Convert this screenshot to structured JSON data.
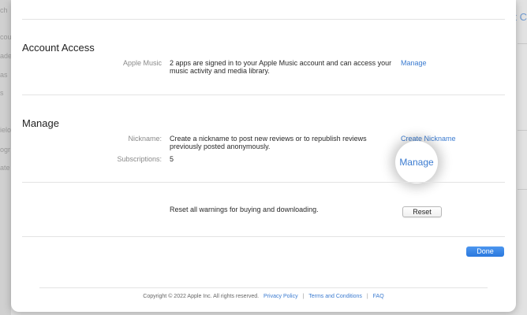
{
  "background": {
    "sidebar_fragments": [
      "ch",
      "cou",
      "ade",
      "as",
      "s",
      "ielo",
      "ogr",
      "ate"
    ],
    "right_fragment": "t C"
  },
  "account_access": {
    "title": "Account Access",
    "apple_music_label": "Apple Music",
    "apple_music_text": "2 apps are signed in to your Apple Music account and can access your music activity and media library.",
    "apple_music_link": "Manage"
  },
  "manage": {
    "title": "Manage",
    "nickname_label": "Nickname:",
    "nickname_text": "Create a nickname to post new reviews or to republish reviews previously posted anonymously.",
    "nickname_link": "Create Nickname",
    "subscriptions_label": "Subscriptions:",
    "subscriptions_value": "5",
    "subscriptions_link": "Manage"
  },
  "reset": {
    "text": "Reset all warnings for buying and downloading.",
    "button": "Reset"
  },
  "done_button": "Done",
  "footer": {
    "copyright": "Copyright © 2022 Apple Inc. All rights reserved.",
    "privacy": "Privacy Policy",
    "separator": "|",
    "terms": "Terms and Conditions",
    "faq": "FAQ"
  },
  "colors": {
    "link": "#3b7bd0",
    "done_button": "#2a78de"
  }
}
